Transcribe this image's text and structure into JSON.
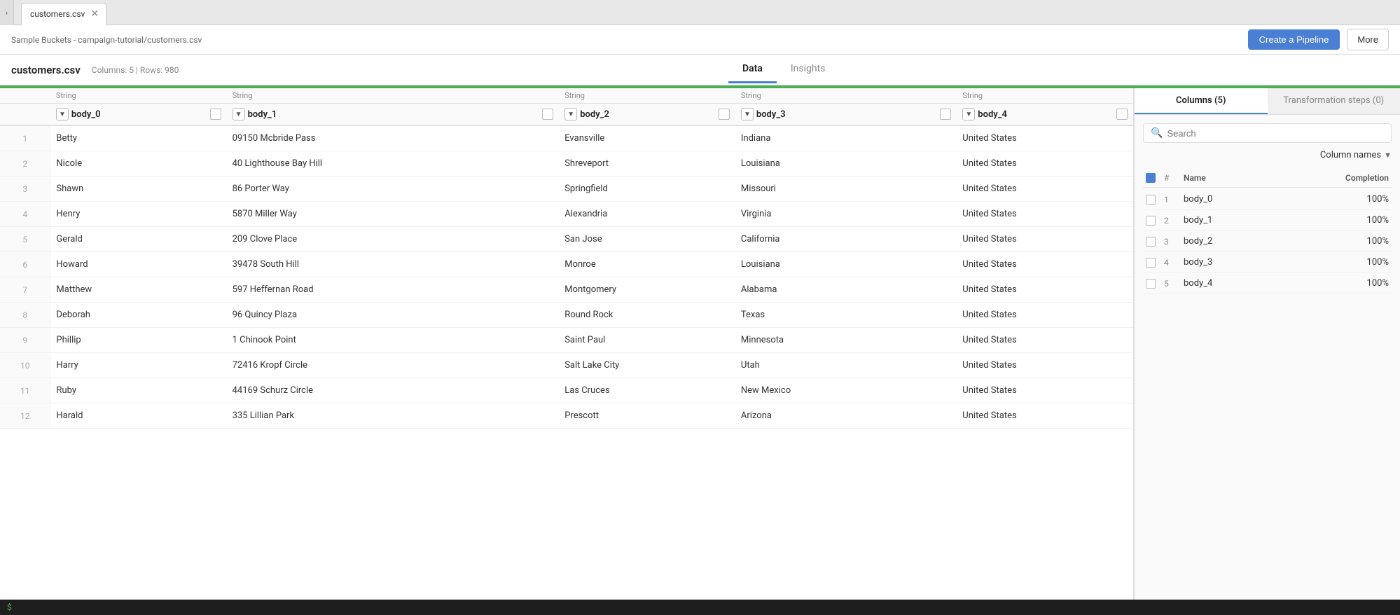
{
  "tabs": [
    {
      "label": "customers.csv",
      "active": true
    }
  ],
  "toolbar": {
    "path": "Sample Buckets - campaign-tutorial/customers.csv",
    "create_pipeline_label": "Create a Pipeline",
    "more_label": "More"
  },
  "file_info": {
    "title": "customers.csv",
    "meta": "Columns: 5 | Rows: 980"
  },
  "center_tabs": [
    {
      "label": "Data",
      "active": true
    },
    {
      "label": "Insights",
      "active": false
    }
  ],
  "table": {
    "green_bar": true,
    "columns": [
      {
        "type": "String",
        "name": "body_0"
      },
      {
        "type": "String",
        "name": "body_1"
      },
      {
        "type": "String",
        "name": "body_2"
      },
      {
        "type": "String",
        "name": "body_3"
      },
      {
        "type": "String",
        "name": "body_4"
      }
    ],
    "rows": [
      {
        "num": 1,
        "body_0": "Betty",
        "body_1": "09150 Mcbride Pass",
        "body_2": "Evansville",
        "body_3": "Indiana",
        "body_4": "United States"
      },
      {
        "num": 2,
        "body_0": "Nicole",
        "body_1": "40 Lighthouse Bay Hill",
        "body_2": "Shreveport",
        "body_3": "Louisiana",
        "body_4": "United States"
      },
      {
        "num": 3,
        "body_0": "Shawn",
        "body_1": "86 Porter Way",
        "body_2": "Springfield",
        "body_3": "Missouri",
        "body_4": "United States"
      },
      {
        "num": 4,
        "body_0": "Henry",
        "body_1": "5870 Miller Way",
        "body_2": "Alexandria",
        "body_3": "Virginia",
        "body_4": "United States"
      },
      {
        "num": 5,
        "body_0": "Gerald",
        "body_1": "209 Clove Place",
        "body_2": "San Jose",
        "body_3": "California",
        "body_4": "United States"
      },
      {
        "num": 6,
        "body_0": "Howard",
        "body_1": "39478 South Hill",
        "body_2": "Monroe",
        "body_3": "Louisiana",
        "body_4": "United States"
      },
      {
        "num": 7,
        "body_0": "Matthew",
        "body_1": "597 Heffernan Road",
        "body_2": "Montgomery",
        "body_3": "Alabama",
        "body_4": "United States"
      },
      {
        "num": 8,
        "body_0": "Deborah",
        "body_1": "96 Quincy Plaza",
        "body_2": "Round Rock",
        "body_3": "Texas",
        "body_4": "United States"
      },
      {
        "num": 9,
        "body_0": "Phillip",
        "body_1": "1 Chinook Point",
        "body_2": "Saint Paul",
        "body_3": "Minnesota",
        "body_4": "United States"
      },
      {
        "num": 10,
        "body_0": "Harry",
        "body_1": "72416 Kropf Circle",
        "body_2": "Salt Lake City",
        "body_3": "Utah",
        "body_4": "United States"
      },
      {
        "num": 11,
        "body_0": "Ruby",
        "body_1": "44169 Schurz Circle",
        "body_2": "Las Cruces",
        "body_3": "New Mexico",
        "body_4": "United States"
      },
      {
        "num": 12,
        "body_0": "Harald",
        "body_1": "335 Lillian Park",
        "body_2": "Prescott",
        "body_3": "Arizona",
        "body_4": "United States"
      }
    ]
  },
  "right_panel": {
    "tabs": [
      {
        "label": "Columns (5)",
        "active": true
      },
      {
        "label": "Transformation steps (0)",
        "active": false
      }
    ],
    "search_placeholder": "Search",
    "col_names_label": "Column names",
    "list_header": {
      "num_label": "#",
      "name_label": "Name",
      "completion_label": "Completion"
    },
    "columns": [
      {
        "num": 1,
        "name": "body_0",
        "completion": "100%"
      },
      {
        "num": 2,
        "name": "body_1",
        "completion": "100%"
      },
      {
        "num": 3,
        "name": "body_2",
        "completion": "100%"
      },
      {
        "num": 4,
        "name": "body_3",
        "completion": "100%"
      },
      {
        "num": 5,
        "name": "body_4",
        "completion": "100%"
      }
    ]
  },
  "status_bar": {
    "text": "$"
  }
}
